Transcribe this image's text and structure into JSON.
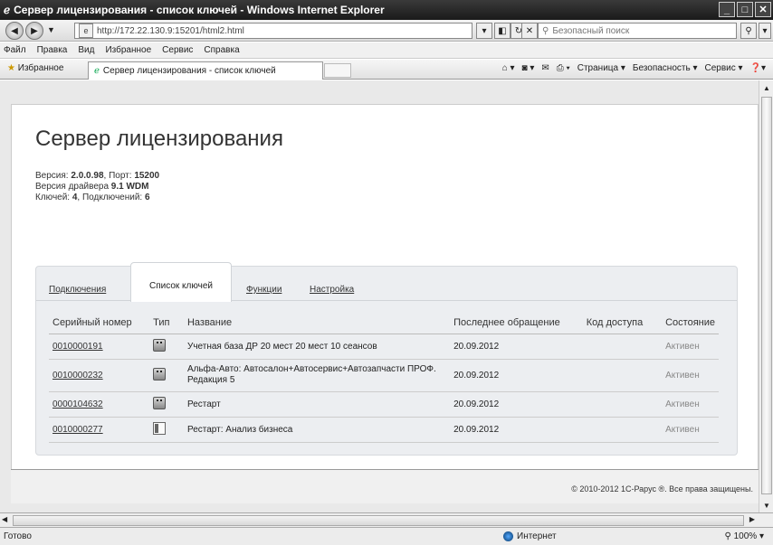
{
  "window": {
    "title": "Сервер лицензирования - список ключей - Windows Internet Explorer"
  },
  "address": {
    "url": "http://172.22.130.9:15201/html2.html",
    "search_placeholder": "Безопасный поиск"
  },
  "menu": {
    "items": [
      "Файл",
      "Правка",
      "Вид",
      "Избранное",
      "Сервис",
      "Справка"
    ]
  },
  "favbar": {
    "favorites": "Избранное",
    "tab": "Сервер лицензирования - список ключей",
    "cmd": [
      "Страница ▾",
      "Безопасность ▾",
      "Сервис ▾"
    ]
  },
  "page": {
    "title": "Сервер лицензирования",
    "info": {
      "version_label": "Версия: ",
      "version": "2.0.0.98",
      "port_label": ", Порт: ",
      "port": "15200",
      "driver_label": "Версия драйвера ",
      "driver": "9.1 WDM",
      "keys_label": "Ключей: ",
      "keys": "4",
      "conn_label": ", Подключений: ",
      "conn": "6"
    },
    "tabs": [
      "Подключения",
      "Список ключей",
      "Функции",
      "Настройка"
    ],
    "table": {
      "headers": [
        "Серийный номер",
        "Тип",
        "Название",
        "Последнее обращение",
        "Код доступа",
        "Состояние"
      ],
      "rows": [
        {
          "serial": "0010000191",
          "type": "usb-key-icon",
          "name": "Учетная база ДР 20 мест 20 мест 10 сеансов",
          "last": "20.09.2012",
          "code": "",
          "state": "Активен"
        },
        {
          "serial": "0010000232",
          "type": "usb-key-icon",
          "name": "Альфа-Авто: Автосалон+Автосервис+Автозапчасти ПРОФ. Редакция 5",
          "last": "20.09.2012",
          "code": "",
          "state": "Активен"
        },
        {
          "serial": "0000104632",
          "type": "usb-key-icon",
          "name": "Рестарт",
          "last": "20.09.2012",
          "code": "",
          "state": "Активен"
        },
        {
          "serial": "0010000277",
          "type": "software-key-icon",
          "name": "Рестарт: Анализ бизнеса",
          "last": "20.09.2012",
          "code": "",
          "state": "Активен"
        }
      ]
    },
    "copyright": "© 2010-2012 1С-Рарус ®. Все права защищены."
  },
  "status": {
    "text": "Готово",
    "zone": "Интернет",
    "zoom": "100%"
  }
}
